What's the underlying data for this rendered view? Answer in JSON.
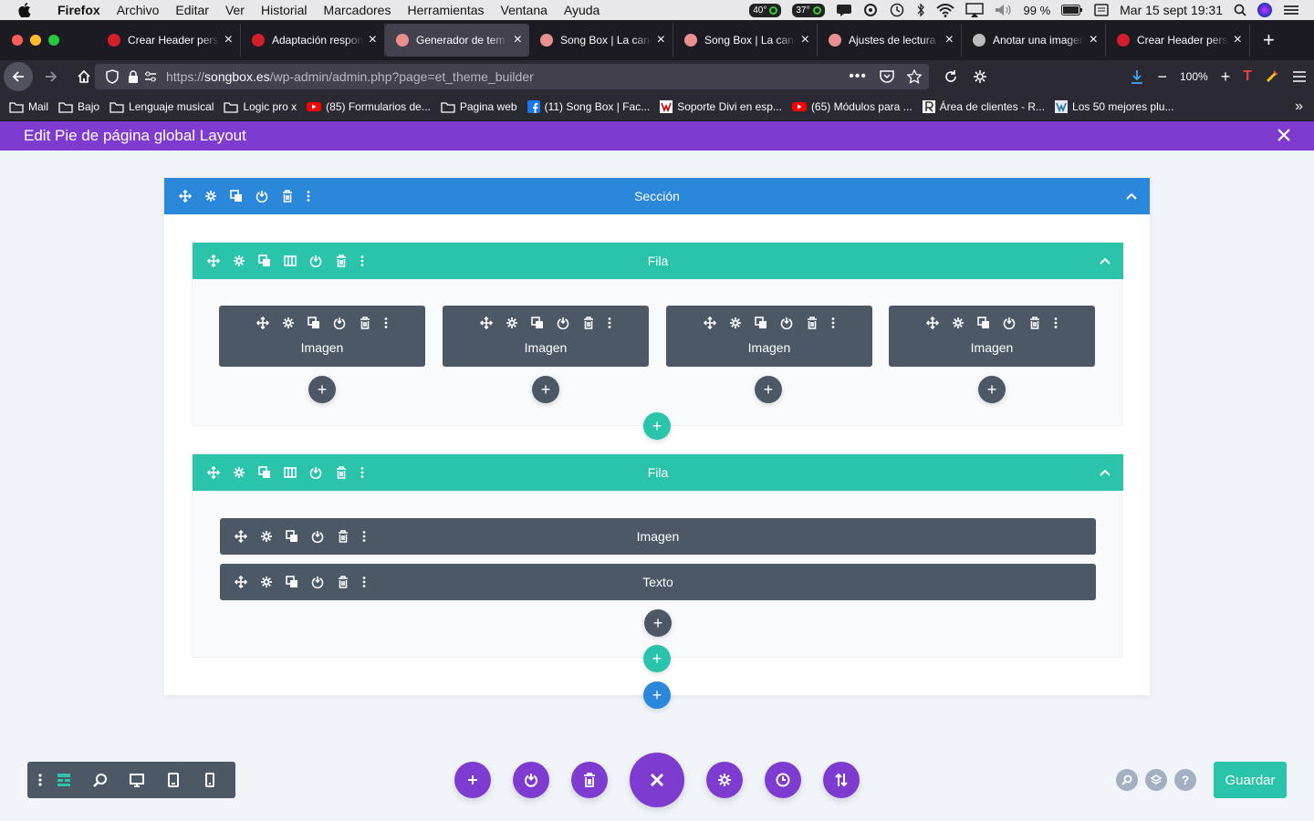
{
  "menubar": {
    "app": "Firefox",
    "items": [
      "Archivo",
      "Editar",
      "Ver",
      "Historial",
      "Marcadores",
      "Herramientas",
      "Ventana",
      "Ayuda"
    ],
    "temp1": "40°",
    "temp2": "37°",
    "battery": "99 %",
    "datetime": "Mar 15 sept  19:31"
  },
  "tabs": [
    {
      "title": "Crear Header perso",
      "favicon": "#d21f2b",
      "active": false
    },
    {
      "title": "Adaptación respon",
      "favicon": "#d21f2b",
      "active": false
    },
    {
      "title": "Generador de tem",
      "favicon": "#e8908e",
      "active": true
    },
    {
      "title": "Song Box | La canc",
      "favicon": "#e8908e",
      "active": false
    },
    {
      "title": "Song Box | La canc",
      "favicon": "#e8908e",
      "active": false
    },
    {
      "title": "Ajustes de lectura",
      "favicon": "#e8908e",
      "active": false
    },
    {
      "title": "Anotar una imagen",
      "favicon": "#bbbbbb",
      "active": false
    },
    {
      "title": "Crear Header pers",
      "favicon": "#d21f2b",
      "active": false
    }
  ],
  "url": {
    "prefix": "https://",
    "host": "songbox.es",
    "path": "/wp-admin/admin.php?page=et_theme_builder"
  },
  "zoom": "100%",
  "bookmarks": [
    {
      "label": "Mail",
      "icon": "folder-icon"
    },
    {
      "label": "Bajo",
      "icon": "folder-icon"
    },
    {
      "label": "Lenguaje musical",
      "icon": "folder-icon"
    },
    {
      "label": "Logic pro x",
      "icon": "folder-icon"
    },
    {
      "label": "(85) Formularios de...",
      "icon": "youtube-icon"
    },
    {
      "label": "Pagina web",
      "icon": "folder-icon"
    },
    {
      "label": "(11) Song Box | Fac...",
      "icon": "facebook-icon"
    },
    {
      "label": "Soporte Divi en esp...",
      "icon": "wolf-icon"
    },
    {
      "label": "(65) Módulos para ...",
      "icon": "youtube-icon"
    },
    {
      "label": "Área de clientes - R...",
      "icon": "r-icon"
    },
    {
      "label": "Los 50 mejores plu...",
      "icon": "w-icon"
    }
  ],
  "builder": {
    "title": "Edit Pie de página global Layout",
    "section_label": "Sección",
    "row1_label": "Fila",
    "row1_modules": [
      "Imagen",
      "Imagen",
      "Imagen",
      "Imagen"
    ],
    "row2_label": "Fila",
    "row2_modules": [
      "Imagen",
      "Texto"
    ],
    "save_label": "Guardar"
  },
  "colors": {
    "purple": "#7e3bd0",
    "section_blue": "#2b87da",
    "row_green": "#29c4a9",
    "module_gray": "#4c5866"
  }
}
